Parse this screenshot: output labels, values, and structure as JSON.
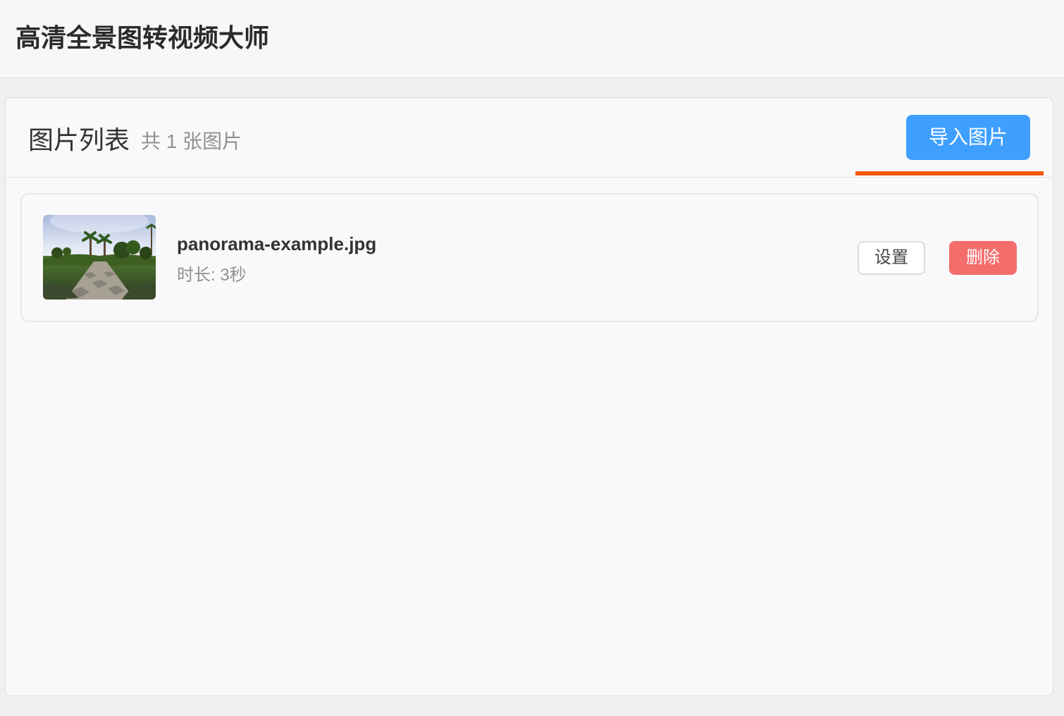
{
  "app": {
    "title": "高清全景图转视频大师"
  },
  "image_list": {
    "title": "图片列表",
    "count_text": "共 1 张图片",
    "import_button_label": "导入图片",
    "items": [
      {
        "file_name": "panorama-example.jpg",
        "duration_text": "时长: 3秒",
        "settings_label": "设置",
        "delete_label": "删除"
      }
    ]
  },
  "colors": {
    "primary_button": "#3f9ffe",
    "accent_underline": "#f2590f",
    "delete_button": "#f56c6c"
  },
  "icons": {
    "thumbnail": "panorama-thumbnail-image"
  }
}
